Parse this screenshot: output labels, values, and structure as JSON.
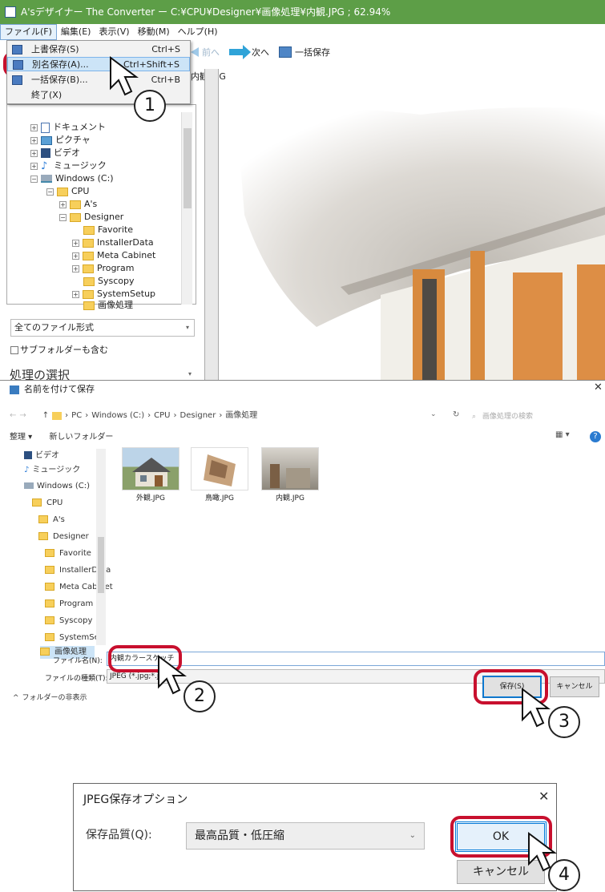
{
  "app": {
    "title": "A'sデザイナー The Converter ー C:¥CPU¥Designer¥画像処理¥内観.JPG ; 62.94%",
    "menu": [
      "ファイル(F)",
      "編集(E)",
      "表示(V)",
      "移動(M)",
      "ヘルプ(H)"
    ],
    "toolbar": {
      "prev": "前へ",
      "next": "次へ",
      "batch_save": "一括保存"
    },
    "current_file": "内観.JPG",
    "file_menu": [
      {
        "label": "上書保存(S)",
        "shortcut": "Ctrl+S"
      },
      {
        "label": "別名保存(A)...",
        "shortcut": "Ctrl+Shift+S"
      },
      {
        "label": "一括保存(B)...",
        "shortcut": "Ctrl+B"
      },
      {
        "label": "終了(X)",
        "shortcut": ""
      }
    ],
    "tree": [
      {
        "label": "ドキュメント",
        "icon": "document-icon",
        "expander": "+"
      },
      {
        "label": "ピクチャ",
        "icon": "picture-icon",
        "expander": "+"
      },
      {
        "label": "ビデオ",
        "icon": "video-icon",
        "expander": "+"
      },
      {
        "label": "ミュージック",
        "icon": "music-icon",
        "expander": "+"
      },
      {
        "label": "Windows (C:)",
        "icon": "drive-icon",
        "expander": "−"
      },
      {
        "label": "CPU",
        "icon": "folder-icon",
        "expander": "−"
      },
      {
        "label": "A's",
        "icon": "folder-icon",
        "expander": "+"
      },
      {
        "label": "Designer",
        "icon": "folder-icon",
        "expander": "−"
      },
      {
        "label": "Favorite",
        "icon": "folder-icon",
        "expander": ""
      },
      {
        "label": "InstallerData",
        "icon": "folder-icon",
        "expander": "+"
      },
      {
        "label": "Meta Cabinet",
        "icon": "folder-icon",
        "expander": "+"
      },
      {
        "label": "Program",
        "icon": "folder-icon",
        "expander": "+"
      },
      {
        "label": "Syscopy",
        "icon": "folder-icon",
        "expander": ""
      },
      {
        "label": "SystemSetup",
        "icon": "folder-icon",
        "expander": "+"
      },
      {
        "label": "画像処理",
        "icon": "folder-icon",
        "expander": ""
      }
    ],
    "file_type_filter": "全てのファイル形式",
    "include_subfolders": "サブフォルダーも含む",
    "process_select": "処理の選択"
  },
  "save_dialog": {
    "title": "名前を付けて保存",
    "breadcrumb": [
      "PC",
      "Windows (C:)",
      "CPU",
      "Designer",
      "画像処理"
    ],
    "search_placeholder": "画像処理の検索",
    "organize": "整理 ▾",
    "new_folder": "新しいフォルダー",
    "nav_tree": [
      "ビデオ",
      "ミュージック",
      "Windows (C:)",
      "CPU",
      "A's",
      "Designer",
      "Favorite",
      "InstallerData",
      "Meta Cabinet",
      "Program",
      "Syscopy",
      "SystemSetup",
      "画像処理"
    ],
    "files": [
      "外観.JPG",
      "鳥瞰.JPG",
      "内観.JPG"
    ],
    "filename_label": "ファイル名(N):",
    "filename_value": "内観カラースケッチ",
    "filetype_label": "ファイルの種類(T):",
    "filetype_value": "JPEG (*.jpg;*.jpeg)",
    "hide_folders": "フォルダーの非表示",
    "save_button": "保存(S)",
    "cancel_button": "キャンセル"
  },
  "jpeg_dialog": {
    "title": "JPEG保存オプション",
    "quality_label": "保存品質(Q):",
    "quality_value": "最高品質・低圧縮",
    "ok_button": "OK",
    "cancel_button": "キャンセル"
  },
  "annotations": [
    "1",
    "2",
    "3",
    "4"
  ],
  "colors": {
    "titlebar": "#5d9e47",
    "highlight": "#c8102e",
    "accent_blue": "#0078d7"
  }
}
